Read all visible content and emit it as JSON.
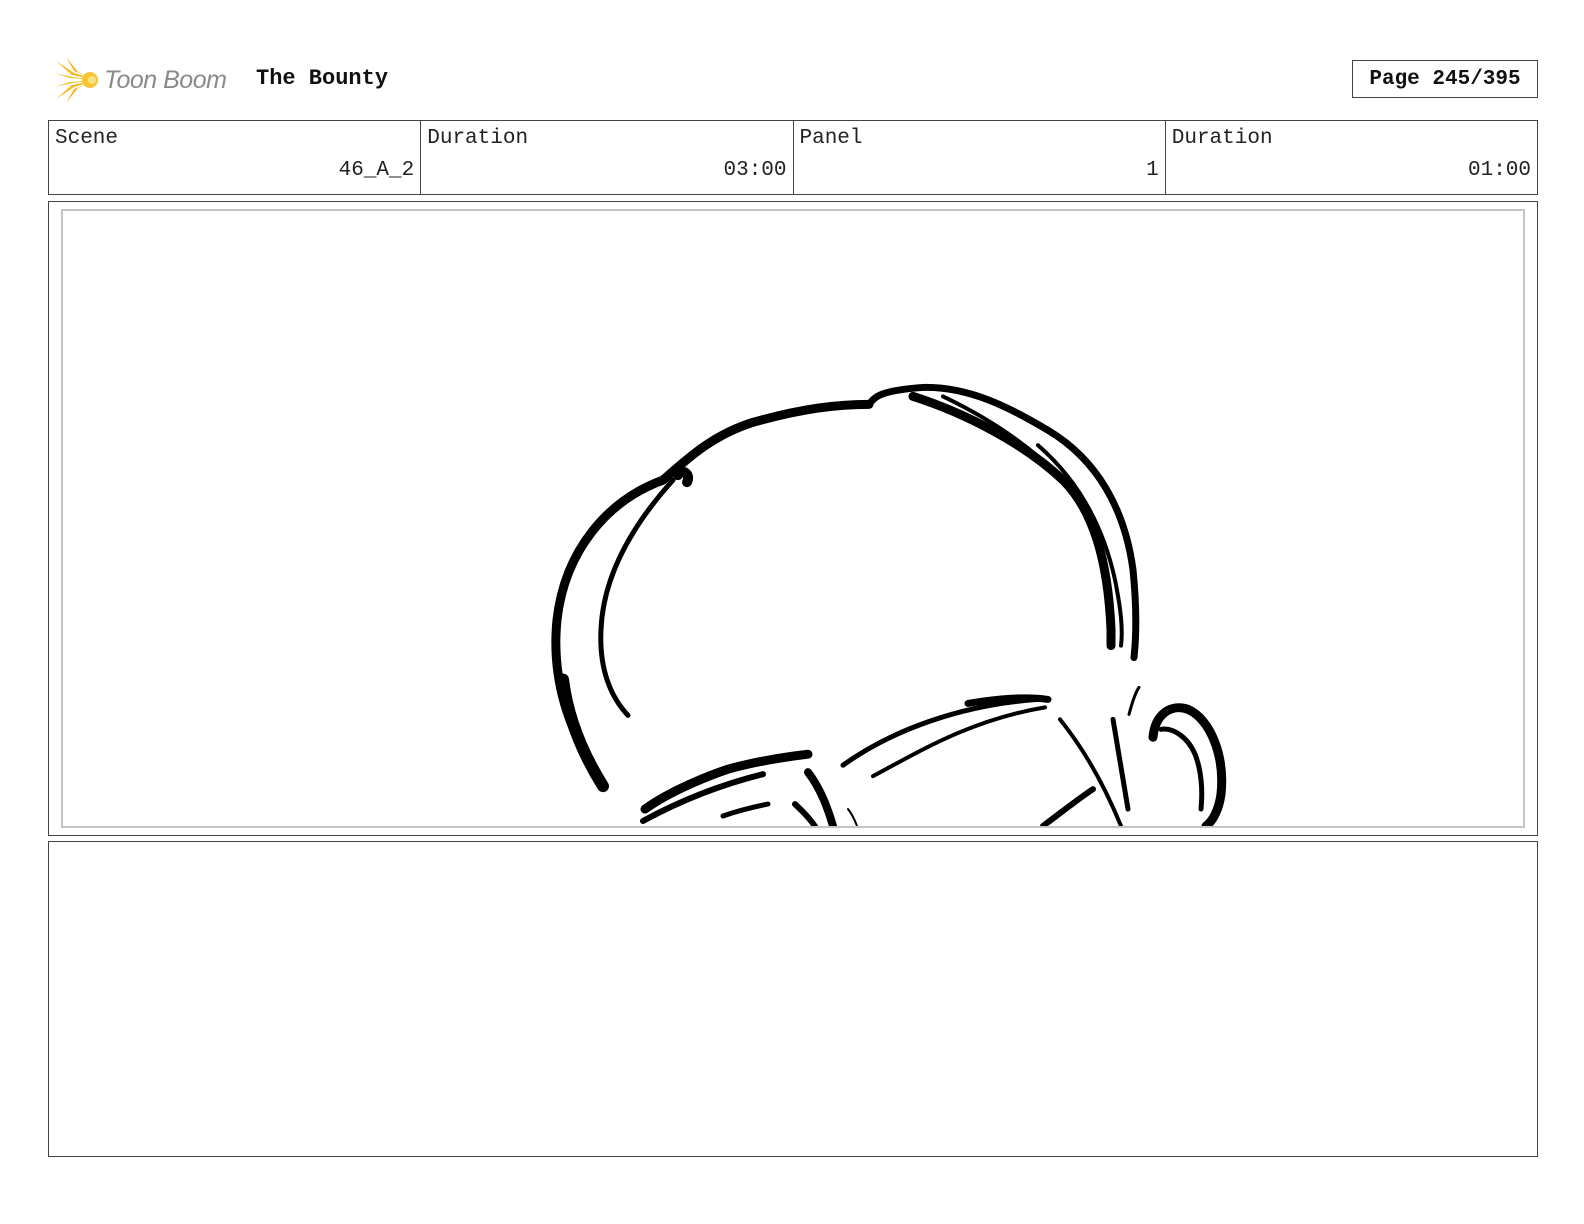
{
  "header": {
    "logo_text": "Toon Boom",
    "project_title": "The Bounty",
    "page_label": "Page 245/395"
  },
  "info": {
    "scene_label": "Scene",
    "scene_value": "46_A_2",
    "scene_duration_label": "Duration",
    "scene_duration_value": "03:00",
    "panel_label": "Panel",
    "panel_value": "1",
    "panel_duration_label": "Duration",
    "panel_duration_value": "01:00"
  },
  "panel": {
    "drawing": "storyboard-sketch-character-head"
  },
  "notes": {
    "text": ""
  }
}
